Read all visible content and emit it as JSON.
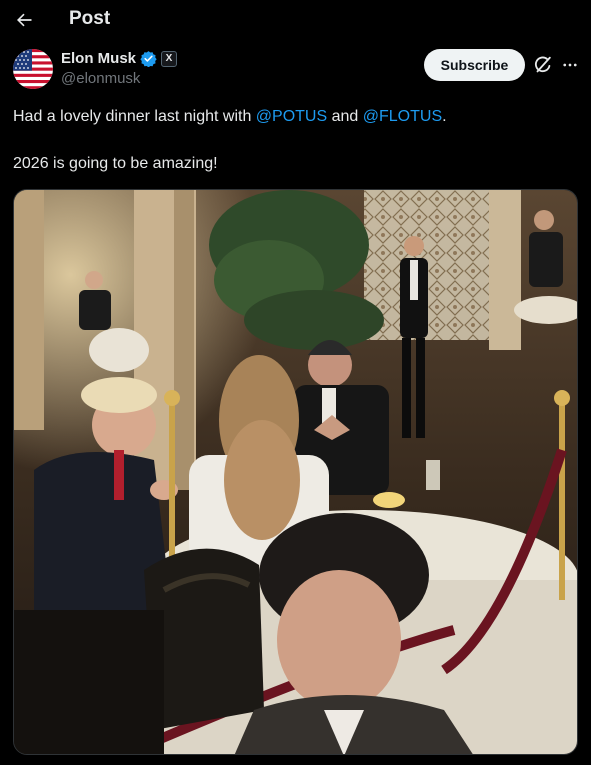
{
  "header": {
    "title": "Post",
    "back_icon": "arrow-left-icon"
  },
  "author": {
    "display_name": "Elon Musk",
    "handle": "@elonmusk",
    "verified_icon": "verified-badge-icon",
    "affiliate_badge": "X"
  },
  "actions": {
    "subscribe_label": "Subscribe",
    "grok_icon": "grok-icon",
    "more_icon": "more-dots-icon"
  },
  "post": {
    "text_before": "Had a lovely dinner last night with ",
    "mention_1": "@POTUS",
    "text_middle": " and ",
    "mention_2": "@FLOTUS",
    "text_after": ".",
    "line_2": "2026 is going to be amazing!"
  },
  "media": {
    "kind": "photo",
    "subject": "dinner-scene-photo"
  },
  "colors": {
    "background": "#000000",
    "text": "#e7e9ea",
    "muted": "#71767b",
    "link": "#1d9bf0",
    "verified": "#1d9bf0"
  }
}
